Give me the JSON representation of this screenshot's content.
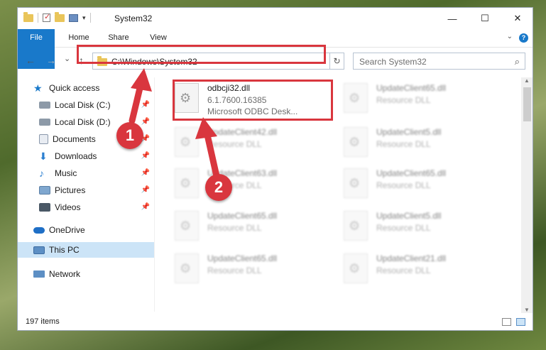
{
  "window": {
    "title": "System32",
    "controls": {
      "minimize": "—",
      "maximize": "☐",
      "close": "✕"
    }
  },
  "ribbon": {
    "tabs": [
      "File",
      "Home",
      "Share",
      "View"
    ],
    "help": "?"
  },
  "navbar": {
    "back": "←",
    "forward": "→",
    "recent": "⌄",
    "up": "↑",
    "address": "C:\\Windows\\System32",
    "refresh": "↻",
    "search_placeholder": "Search System32",
    "search_icon": "⌕"
  },
  "sidebar": {
    "items": [
      {
        "label": "Quick access",
        "icon": "star-icon",
        "pinned": false
      },
      {
        "label": "Local Disk (C:)",
        "icon": "drive-icon",
        "pinned": true
      },
      {
        "label": "Local Disk (D:)",
        "icon": "drive-icon",
        "pinned": true
      },
      {
        "label": "Documents",
        "icon": "documents-icon",
        "pinned": true
      },
      {
        "label": "Downloads",
        "icon": "downloads-icon",
        "pinned": true
      },
      {
        "label": "Music",
        "icon": "music-icon",
        "pinned": true
      },
      {
        "label": "Pictures",
        "icon": "pictures-icon",
        "pinned": true
      },
      {
        "label": "Videos",
        "icon": "videos-icon",
        "pinned": true
      },
      {
        "label": "OneDrive",
        "icon": "cloud-icon",
        "pinned": false
      },
      {
        "label": "This PC",
        "icon": "computer-icon",
        "pinned": false,
        "selected": true
      },
      {
        "label": "Network",
        "icon": "network-icon",
        "pinned": false
      }
    ]
  },
  "files": [
    {
      "name": "odbcji32.dll",
      "line2": "6.1.7600.16385",
      "line3": "Microsoft ODBC Desk...",
      "highlight": true
    },
    {
      "name": "UpdateClient65.dll",
      "line2": "Resource DLL"
    },
    {
      "name": "UpdateClient42.dll",
      "line2": "Resource DLL"
    },
    {
      "name": "UpdateClient5.dll",
      "line2": "Resource DLL"
    },
    {
      "name": "UpdateClient63.dll",
      "line2": "Resource DLL"
    },
    {
      "name": "UpdateClient65.dll",
      "line2": "Resource DLL"
    },
    {
      "name": "UpdateClient65.dll",
      "line2": "Resource DLL"
    },
    {
      "name": "UpdateClient5.dll",
      "line2": "Resource DLL"
    },
    {
      "name": "UpdateClient65.dll",
      "line2": "Resource DLL"
    },
    {
      "name": "UpdateClient21.dll",
      "line2": "Resource DLL"
    }
  ],
  "status": {
    "item_count": "197 items"
  },
  "callouts": [
    "1",
    "2"
  ],
  "colors": {
    "accent": "#1979ca",
    "annotation": "#d9363e",
    "selection": "#cce4f7"
  }
}
